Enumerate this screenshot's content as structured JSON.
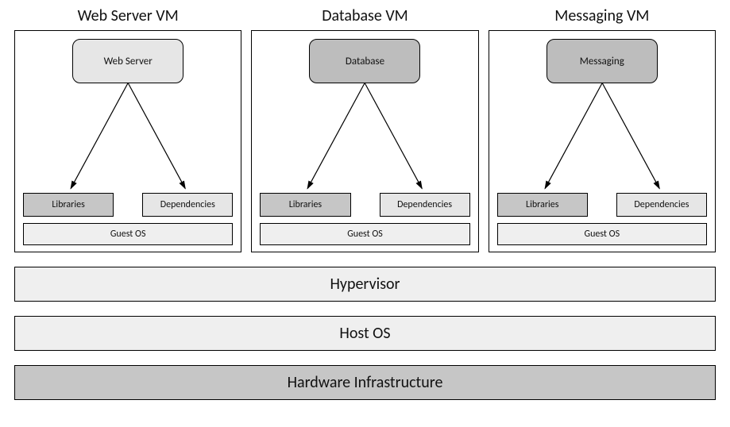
{
  "vms": [
    {
      "title": "Web Server VM",
      "app": "Web Server",
      "appShade": "light",
      "libraries": "Libraries",
      "dependencies": "Dependencies",
      "guestOS": "Guest OS"
    },
    {
      "title": "Database VM",
      "app": "Database",
      "appShade": "dark",
      "libraries": "Libraries",
      "dependencies": "Dependencies",
      "guestOS": "Guest OS"
    },
    {
      "title": "Messaging VM",
      "app": "Messaging",
      "appShade": "dark",
      "libraries": "Libraries",
      "dependencies": "Dependencies",
      "guestOS": "Guest OS"
    }
  ],
  "layers": {
    "hypervisor": "Hypervisor",
    "hostOS": "Host OS",
    "hardware": "Hardware Infrastructure"
  }
}
